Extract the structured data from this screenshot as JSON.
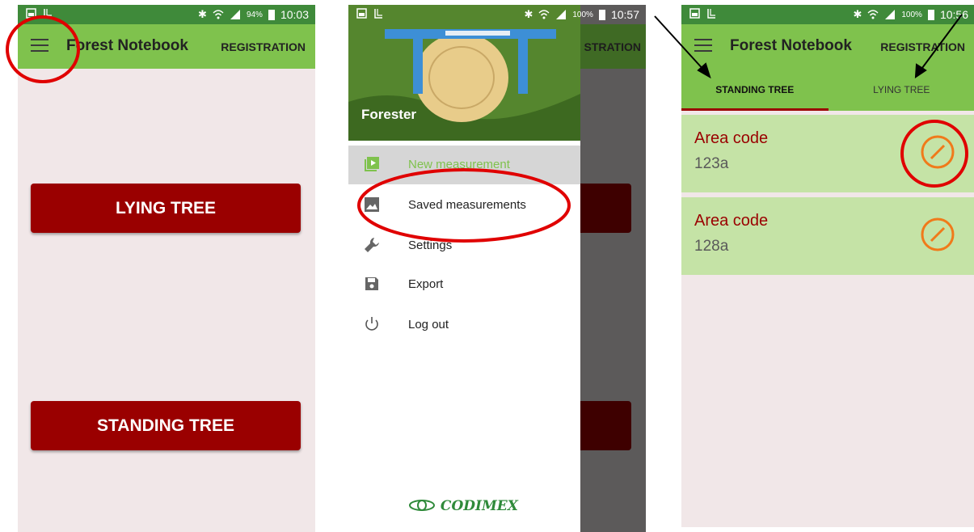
{
  "status_bars": [
    {
      "battery": "94%",
      "time": "10:03"
    },
    {
      "battery": "100%",
      "time": "10:57"
    },
    {
      "battery": "100%",
      "time": "10:56"
    }
  ],
  "screen_home": {
    "title": "Forest Notebook",
    "registration": "REGISTRATION",
    "lying_tree": "LYING TREE",
    "standing_tree": "STANDING TREE"
  },
  "screen_drawer": {
    "user_name": "Forester",
    "registration_partial": "STRATION",
    "items": [
      {
        "label": "New measurement",
        "icon": "video-library-icon"
      },
      {
        "label": "Saved measurements",
        "icon": "photo-icon"
      },
      {
        "label": "Settings",
        "icon": "wrench-icon"
      },
      {
        "label": "Export",
        "icon": "save-icon"
      },
      {
        "label": "Log out",
        "icon": "power-icon"
      }
    ],
    "brand": "CODIMEX"
  },
  "screen_list": {
    "title": "Forest Notebook",
    "registration": "REGISTRATION",
    "tabs": [
      "STANDING TREE",
      "LYING TREE"
    ],
    "active_tab": "STANDING TREE",
    "cards": [
      {
        "label": "Area code",
        "value": "123a"
      },
      {
        "label": "Area code",
        "value": "128a"
      }
    ]
  },
  "colors": {
    "status_bar": "#3f8a3a",
    "app_bar": "#7fc24d",
    "button": "#9a0000",
    "card": "#c5e3a6",
    "annotation": "#e00000",
    "edit_icon": "#f07a1a"
  }
}
